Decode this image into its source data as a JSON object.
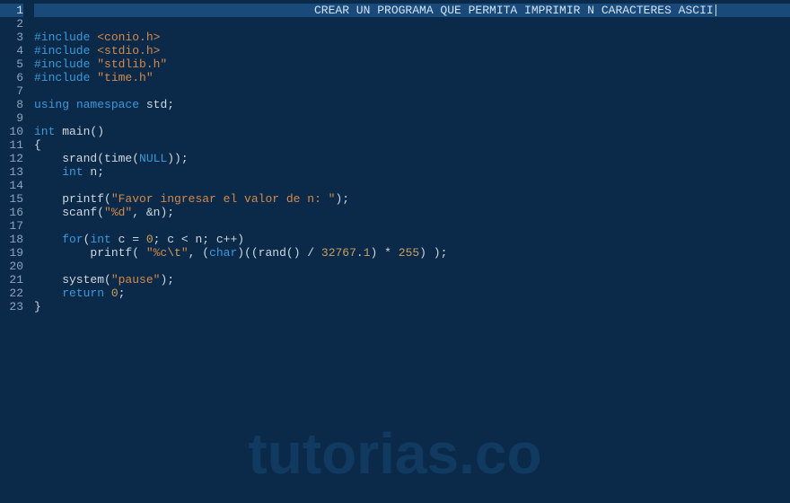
{
  "header": {
    "title_selected": "CREAR UN PROGRAMA QUE PERMITA IMPRIMIR N CARACTERES ASCII"
  },
  "watermark": "tutorias.co",
  "lines": {
    "count": 23,
    "l3": {
      "pre": "#include ",
      "ang": "<conio.h>"
    },
    "l4": {
      "pre": "#include ",
      "ang": "<stdio.h>"
    },
    "l5": {
      "pre": "#include ",
      "str": "\"stdlib.h\""
    },
    "l6": {
      "pre": "#include ",
      "str": "\"time.h\""
    },
    "l8": {
      "a": "using",
      "b": " ",
      "c": "namespace",
      "d": " std;"
    },
    "l10": {
      "a": "int",
      "b": " main()"
    },
    "l11": "{",
    "l12": {
      "a": "    srand(time(",
      "b": "NULL",
      "c": "));"
    },
    "l13": {
      "a": "    ",
      "b": "int",
      "c": " n;"
    },
    "l15": {
      "a": "    printf(",
      "b": "\"Favor ingresar el valor de n: \"",
      "c": ");"
    },
    "l16": {
      "a": "    scanf(",
      "b": "\"%d\"",
      "c": ", &n);"
    },
    "l18": {
      "a": "    ",
      "b": "for",
      "c": "(",
      "d": "int",
      "e": " c = ",
      "f": "0",
      "g": "; c < n; c++)"
    },
    "l19": {
      "a": "        printf( ",
      "b": "\"%c",
      "esc": "\\t",
      "b2": "\"",
      "c": ", (",
      "d": "char",
      "e": ")((rand() / ",
      "f": "32767",
      "g": ".",
      "h": "1",
      "i": ") * ",
      "j": "255",
      "k": ") );"
    },
    "l21": {
      "a": "    system(",
      "b": "\"pause\"",
      "c": ");"
    },
    "l22": {
      "a": "    ",
      "b": "return",
      "c": " ",
      "d": "0",
      "e": ";"
    },
    "l23": "}"
  }
}
